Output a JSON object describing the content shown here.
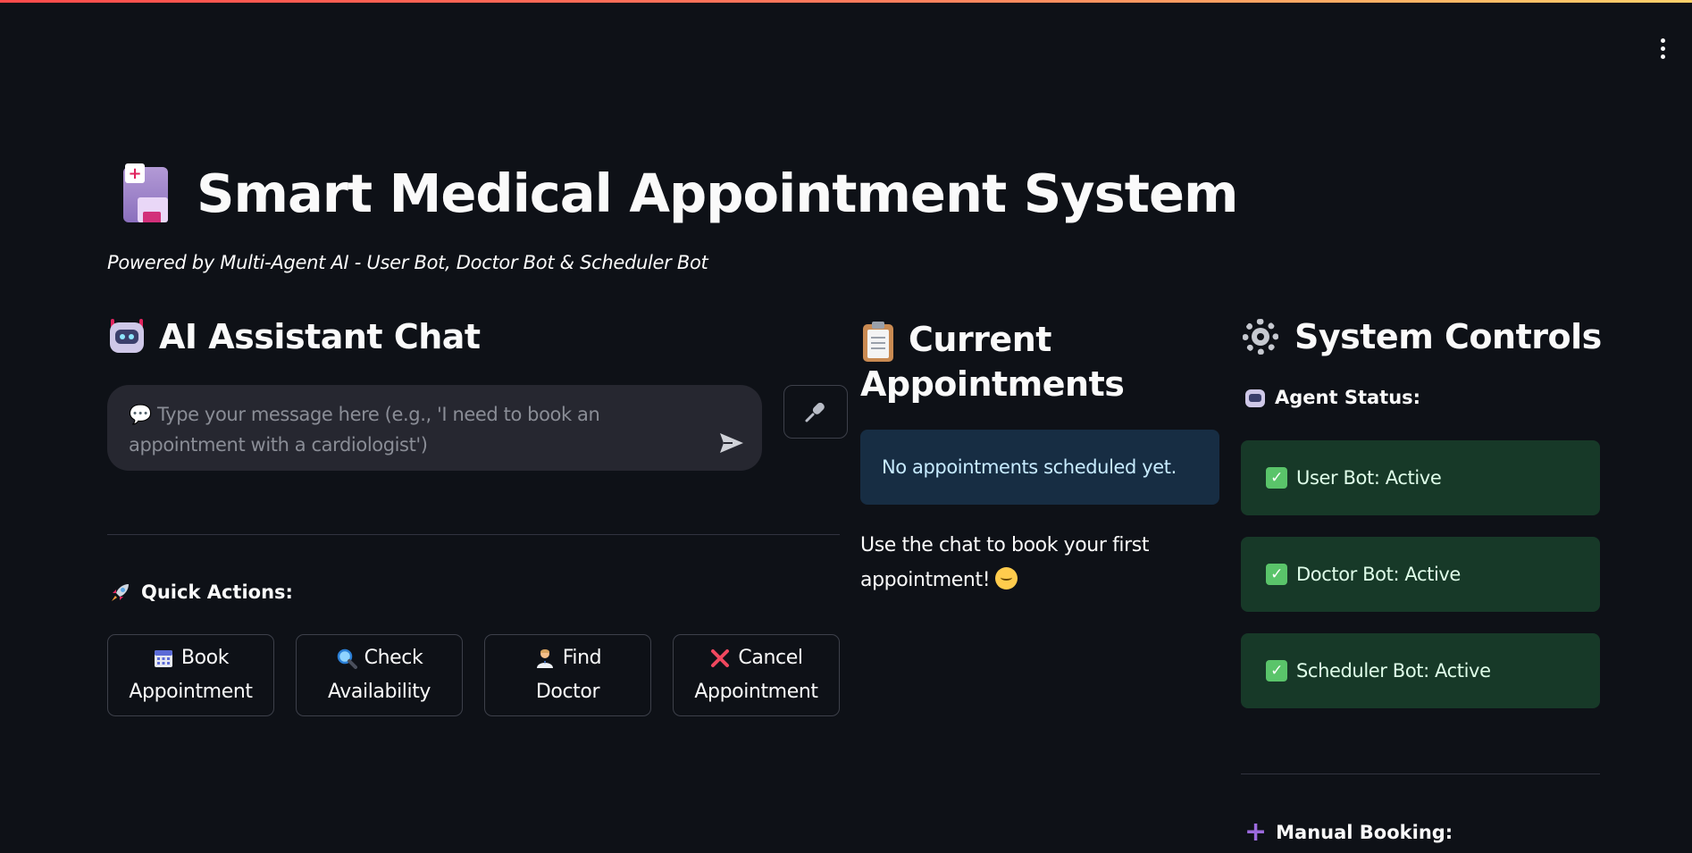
{
  "header": {
    "title": "Smart Medical Appointment System",
    "subtitle": "Powered by Multi-Agent AI - User Bot, Doctor Bot & Scheduler Bot"
  },
  "chat": {
    "heading": "AI Assistant Chat",
    "input_placeholder": "💬 Type your message here (e.g., 'I need to book an appointment with a cardiologist')",
    "input_value": ""
  },
  "quick_actions": {
    "label": "Quick Actions:",
    "buttons": [
      {
        "icon": "calendar-icon",
        "line1": "Book",
        "line2": "Appointment"
      },
      {
        "icon": "magnifier-icon",
        "line1": "Check",
        "line2": "Availability"
      },
      {
        "icon": "doctor-icon",
        "line1": "Find",
        "line2": "Doctor"
      },
      {
        "icon": "cross-mark-icon",
        "line1": "Cancel",
        "line2": "Appointment"
      }
    ]
  },
  "appointments": {
    "heading_line1": "Current",
    "heading_line2": "Appointments",
    "empty_message": "No appointments scheduled yet.",
    "hint_line1": "Use the chat to book your first",
    "hint_line2": "appointment!"
  },
  "system_controls": {
    "heading": "System Controls",
    "agent_status_label": "Agent Status:",
    "agents": [
      {
        "label": "User Bot: Active"
      },
      {
        "label": "Doctor Bot: Active"
      },
      {
        "label": "Scheduler Bot: Active"
      }
    ],
    "manual_booking_label": "Manual Booking:"
  },
  "colors": {
    "background": "#0e1117",
    "info_box": "#172d43",
    "success_box": "#173928",
    "accent_bar": "#ff4b4b"
  }
}
